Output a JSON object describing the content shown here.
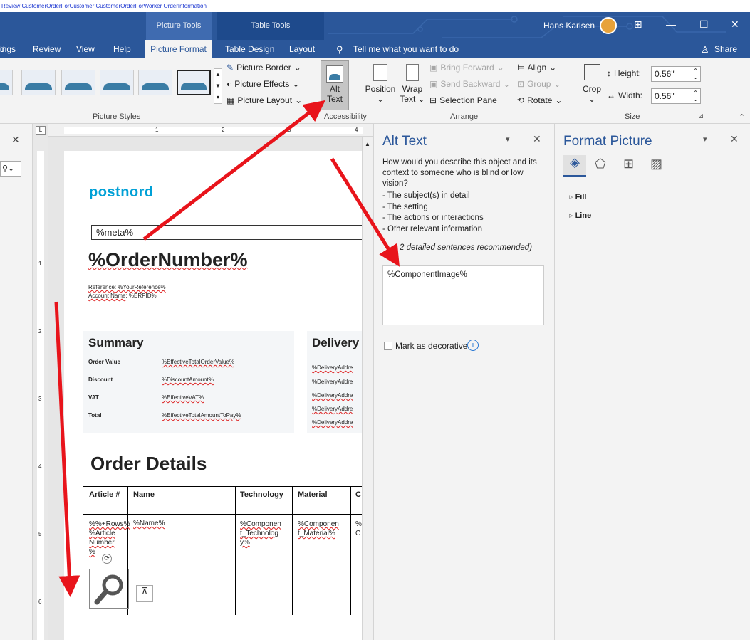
{
  "crumb": "Review  CustomerOrderForCustomer  CustomerOrderForWorker  OrderInformation",
  "titlebar": {
    "ctx_left": "Picture Tools",
    "ctx_right": "Table Tools",
    "user": "Hans Karlsen",
    "minimize": "—",
    "maximize": "☐",
    "close": "✕"
  },
  "tabs": [
    {
      "label": "d"
    },
    {
      "label": "ings"
    },
    {
      "label": "Review"
    },
    {
      "label": "View"
    },
    {
      "label": "Help"
    },
    {
      "label": "Picture Format"
    },
    {
      "label": "Table Design"
    },
    {
      "label": "Layout"
    }
  ],
  "tellme": "Tell me what you want to do",
  "share": "Share",
  "ribbon": {
    "picture_border": "Picture Border",
    "picture_effects": "Picture Effects",
    "picture_layout": "Picture Layout",
    "alt_text_1": "Alt",
    "alt_text_2": "Text",
    "position": "Position",
    "wrap_1": "Wrap",
    "wrap_2": "Text",
    "bring_forward": "Bring Forward",
    "send_backward": "Send Backward",
    "selection_pane": "Selection Pane",
    "align": "Align",
    "group": "Group",
    "rotate": "Rotate",
    "crop": "Crop",
    "height_label": "Height:",
    "height_value": "0.56\"",
    "width_label": "Width:",
    "width_value": "0.56\"",
    "group_picture_styles": "Picture Styles",
    "group_accessibility": "Accessibility",
    "group_arrange": "Arrange",
    "group_size": "Size"
  },
  "ruler": {
    "n1": "1",
    "n2": "2",
    "n3": "3",
    "n4": "4"
  },
  "vruler": [
    "1",
    "2",
    "3",
    "4",
    "5",
    "6"
  ],
  "doc": {
    "logo": "postnord",
    "meta": "%meta%",
    "order_number": "%OrderNumber%",
    "reference_label": "Reference",
    "reference_value": ": %YourReference%",
    "account_label": "Account Name",
    "account_value": ": %ERPID%",
    "summary_title": "Summary",
    "summary_rows": [
      {
        "label": "Order Value",
        "value": "%EffectiveTotalOrderValue%"
      },
      {
        "label": "Discount",
        "value": "%DiscountAmount%"
      },
      {
        "label": "VAT",
        "value": "%EffectiveVAT%"
      },
      {
        "label": "Total",
        "value": "%EffectiveTotalAmountToPay%"
      }
    ],
    "delivery_title": "Delivery",
    "delivery_rows": [
      "%DeliveryAddre",
      "%DeliveryAddre",
      "%DeliveryAddre",
      "%DeliveryAddre",
      "%DeliveryAddre"
    ],
    "order_details": "Order Details",
    "table_headers": [
      "Article #",
      "Name",
      "Technology",
      "Material",
      "C"
    ],
    "table_row": [
      "%%+Rows%\n%Article\nNumber\n%",
      "%Name%",
      "%Componen\nt_Technolog\ny%",
      "%Componen\nt_Material%",
      "%\nC"
    ]
  },
  "alttext": {
    "title": "Alt Text",
    "desc": "How would you describe this object and its context to someone who is blind or low vision?",
    "bullets": [
      "- The subject(s) in detail",
      "- The setting",
      "- The actions or interactions",
      "- Other relevant information"
    ],
    "hint": "(1-2 detailed sentences recommended)",
    "hint_visible": "2 detailed sentences recommended)",
    "value": "%ComponentImage%",
    "decorative": "Mark as decorative"
  },
  "formatpic": {
    "title": "Format Picture",
    "fill": "Fill",
    "line": "Line"
  },
  "colors": {
    "brand": "#2b579a",
    "postnord": "#00a0d6",
    "arrow": "#e8141b"
  }
}
